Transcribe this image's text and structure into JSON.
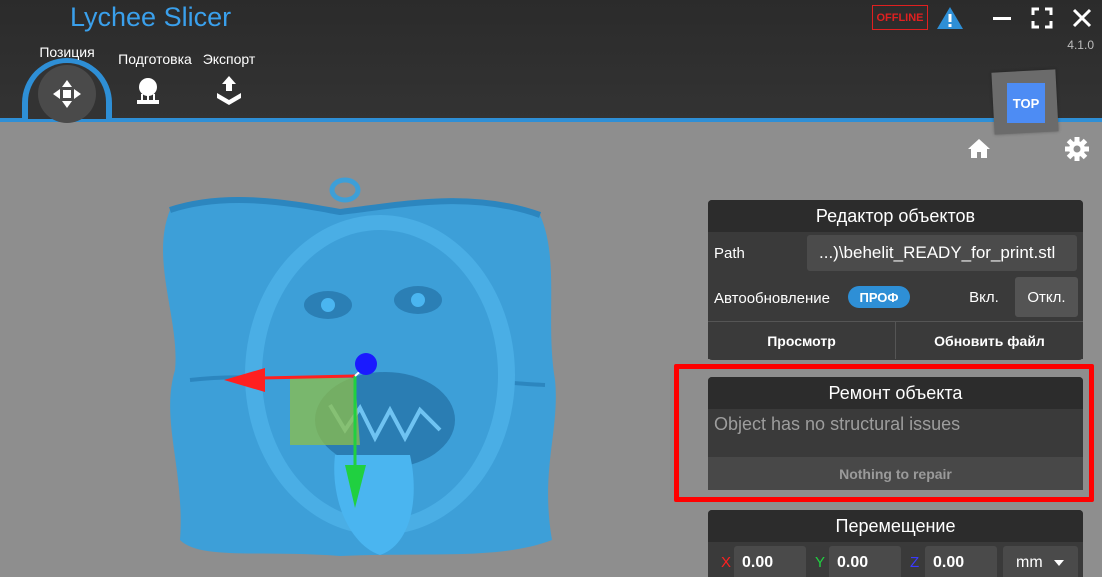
{
  "app": {
    "title": "Lychee Slicer",
    "version": "4.1.0",
    "offline_label": "OFFLINE"
  },
  "tabs": [
    {
      "label": "Позиция",
      "icon": "move-arrows-icon",
      "active": true
    },
    {
      "label": "Подготовка",
      "icon": "supports-icon",
      "active": false
    },
    {
      "label": "Экспорт",
      "icon": "export-icon",
      "active": false
    }
  ],
  "viewport": {
    "view_cube_label": "TOP"
  },
  "object_editor": {
    "title": "Редактор объектов",
    "path_label": "Path",
    "path_value": "...)\\behelit_READY_for_print.stl",
    "auto_update_label": "Автообновление",
    "pro_badge": "ПРОФ",
    "on_label": "Вкл.",
    "off_label": "Откл.",
    "preview_label": "Просмотр",
    "update_file_label": "Обновить файл"
  },
  "repair": {
    "title": "Ремонт объекта",
    "message": "Object has no structural issues",
    "button": "Nothing to repair"
  },
  "move": {
    "title": "Перемещение",
    "x_label": "X",
    "x_value": "0.00",
    "y_label": "Y",
    "y_value": "0.00",
    "z_label": "Z",
    "z_value": "0.00",
    "unit": "mm"
  },
  "colors": {
    "accent": "#2e8fd6",
    "title": "#3aa0ec",
    "model": "#3d9fd8",
    "offline": "#e02020",
    "x_axis": "#ff2020",
    "y_axis": "#20d040",
    "z_axis": "#1a1aff",
    "highlight_frame": "#ff0000"
  }
}
